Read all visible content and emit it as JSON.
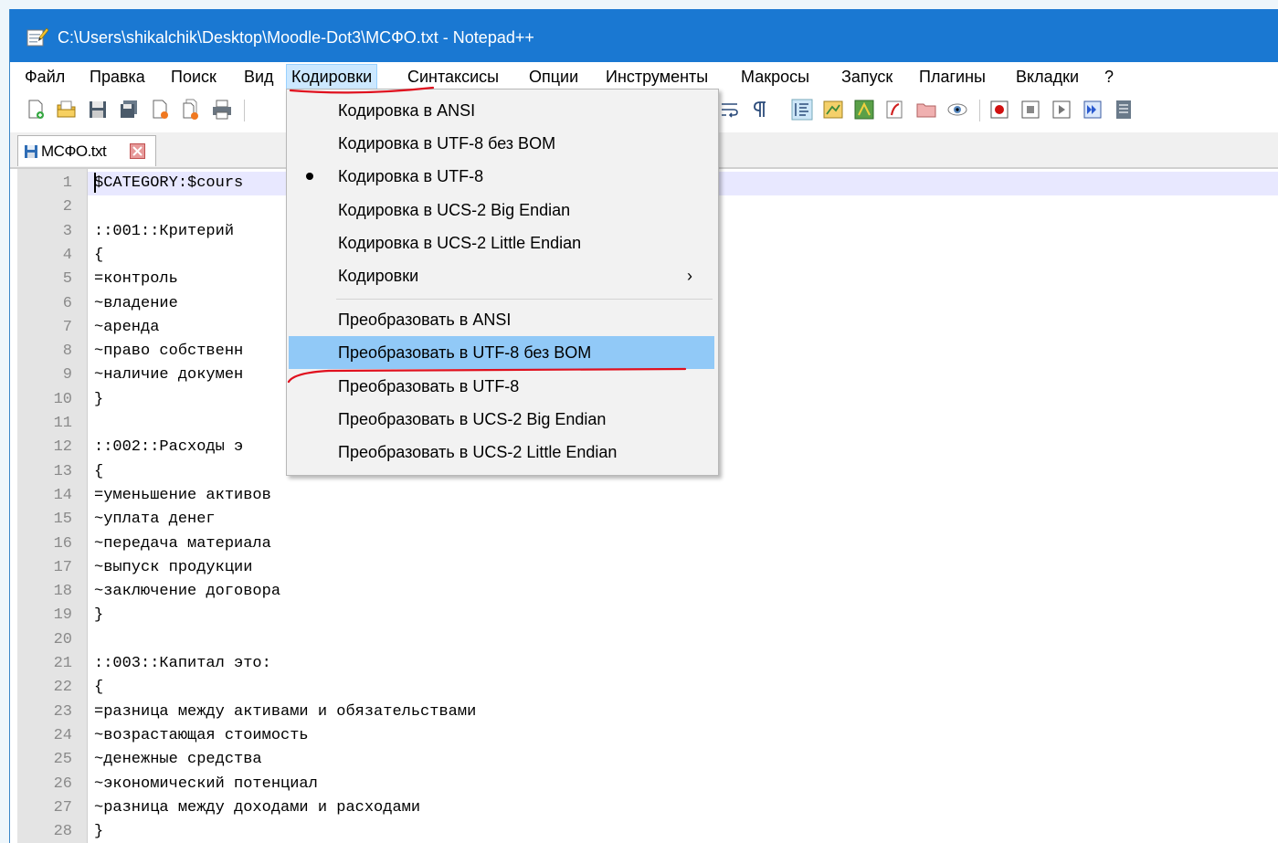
{
  "window": {
    "title": "C:\\Users\\shikalchik\\Desktop\\Moodle-Dot3\\МСФО.txt - Notepad++"
  },
  "menubar": {
    "items": [
      {
        "label": "Файл"
      },
      {
        "label": "Правка"
      },
      {
        "label": "Поиск"
      },
      {
        "label": "Вид"
      },
      {
        "label": "Кодировки"
      },
      {
        "label": "Синтаксисы"
      },
      {
        "label": "Опции"
      },
      {
        "label": "Инструменты"
      },
      {
        "label": "Макросы"
      },
      {
        "label": "Запуск"
      },
      {
        "label": "Плагины"
      },
      {
        "label": "Вкладки"
      },
      {
        "label": "?"
      }
    ],
    "active": "Кодировки"
  },
  "toolbar": {
    "icons": [
      "new-file-icon",
      "open-file-icon",
      "save-icon",
      "save-all-icon",
      "close-icon",
      "close-all-icon",
      "print-icon",
      "cut-icon",
      "wrap-icon",
      "show-all-chars-icon",
      "indent-guide-icon",
      "doc-map-icon",
      "function-list-icon",
      "folder-workspace-icon",
      "monitoring-icon",
      "macro-record-icon",
      "macro-stop-icon",
      "macro-play-icon",
      "macro-run-multiple-icon",
      "macro-save-icon"
    ]
  },
  "tab": {
    "label": "МСФО.txt"
  },
  "editor": {
    "lines": [
      {
        "n": "1",
        "text": "$CATEGORY:$cours"
      },
      {
        "n": "2",
        "text": ""
      },
      {
        "n": "3",
        "text": "::001::Критерий"
      },
      {
        "n": "4",
        "text": "{"
      },
      {
        "n": "5",
        "text": "=контроль"
      },
      {
        "n": "6",
        "text": "~владение"
      },
      {
        "n": "7",
        "text": "~аренда"
      },
      {
        "n": "8",
        "text": "~право собственн"
      },
      {
        "n": "9",
        "text": "~наличие докумен"
      },
      {
        "n": "10",
        "text": "}"
      },
      {
        "n": "11",
        "text": ""
      },
      {
        "n": "12",
        "text": "::002::Расходы э"
      },
      {
        "n": "13",
        "text": "{"
      },
      {
        "n": "14",
        "text": "=уменьшение активов"
      },
      {
        "n": "15",
        "text": "~уплата денег"
      },
      {
        "n": "16",
        "text": "~передача материала"
      },
      {
        "n": "17",
        "text": "~выпуск продукции"
      },
      {
        "n": "18",
        "text": "~заключение договора"
      },
      {
        "n": "19",
        "text": "}"
      },
      {
        "n": "20",
        "text": ""
      },
      {
        "n": "21",
        "text": "::003::Капитал это:"
      },
      {
        "n": "22",
        "text": "{"
      },
      {
        "n": "23",
        "text": "=разница между активами и обязательствами"
      },
      {
        "n": "24",
        "text": "~возрастающая стоимость"
      },
      {
        "n": "25",
        "text": "~денежные средства"
      },
      {
        "n": "26",
        "text": "~экономический потенциал"
      },
      {
        "n": "27",
        "text": "~разница между доходами и расходами"
      },
      {
        "n": "28",
        "text": "}"
      }
    ]
  },
  "encoding_menu": {
    "items": [
      {
        "label": "Кодировка в ANSI",
        "checked": false
      },
      {
        "label": "Кодировка в UTF-8 без BOM",
        "checked": false
      },
      {
        "label": "Кодировка в UTF-8",
        "checked": true
      },
      {
        "label": "Кодировка в UCS-2 Big Endian",
        "checked": false
      },
      {
        "label": "Кодировка в UCS-2 Little Endian",
        "checked": false
      },
      {
        "label": "Кодировки",
        "submenu": true
      },
      {
        "label": "Преобразовать в ANSI"
      },
      {
        "label": "Преобразовать в UTF-8 без BOM",
        "highlighted": true
      },
      {
        "label": "Преобразовать в UTF-8"
      },
      {
        "label": "Преобразовать в UCS-2 Big Endian"
      },
      {
        "label": "Преобразовать в UCS-2 Little Endian"
      }
    ],
    "submenu_arrow": "›"
  },
  "colors": {
    "titlebar": "#1a78d2",
    "menu_highlight": "#91c9f7",
    "annotation_ink": "#e0101e",
    "current_line": "#e8e8ff"
  }
}
